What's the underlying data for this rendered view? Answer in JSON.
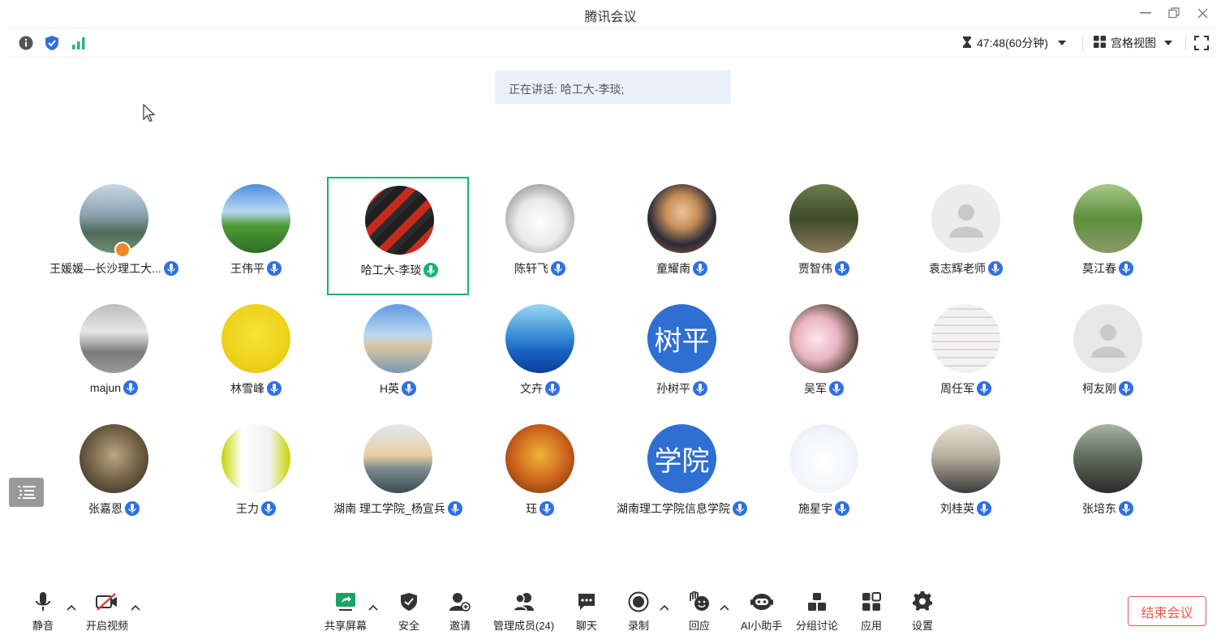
{
  "window": {
    "title": "腾讯会议"
  },
  "infobar": {
    "timer": "47:48(60分钟)",
    "view_mode": "宫格视图"
  },
  "speaking": {
    "label": "正在讲话:",
    "names": "哈工大-李琰;"
  },
  "participants": [
    {
      "name": "王媛媛—长沙理工大...",
      "active": false,
      "host": true,
      "avatar_text": ""
    },
    {
      "name": "王伟平",
      "active": false,
      "host": false,
      "avatar_text": ""
    },
    {
      "name": "哈工大-李琰",
      "active": true,
      "host": false,
      "avatar_text": ""
    },
    {
      "name": "陈轩飞",
      "active": false,
      "host": false,
      "avatar_text": ""
    },
    {
      "name": "童耀南",
      "active": false,
      "host": false,
      "avatar_text": ""
    },
    {
      "name": "贾智伟",
      "active": false,
      "host": false,
      "avatar_text": ""
    },
    {
      "name": "袁志辉老师",
      "active": false,
      "host": false,
      "avatar_text": ""
    },
    {
      "name": "莫江春",
      "active": false,
      "host": false,
      "avatar_text": ""
    },
    {
      "name": "majun",
      "active": false,
      "host": false,
      "avatar_text": ""
    },
    {
      "name": "林雪峰",
      "active": false,
      "host": false,
      "avatar_text": ""
    },
    {
      "name": "H英",
      "active": false,
      "host": false,
      "avatar_text": ""
    },
    {
      "name": "文卉",
      "active": false,
      "host": false,
      "avatar_text": ""
    },
    {
      "name": "孙树平",
      "active": false,
      "host": false,
      "avatar_text": "树平"
    },
    {
      "name": "吴军",
      "active": false,
      "host": false,
      "avatar_text": ""
    },
    {
      "name": "周任军",
      "active": false,
      "host": false,
      "avatar_text": ""
    },
    {
      "name": "柯友刚",
      "active": false,
      "host": false,
      "avatar_text": ""
    },
    {
      "name": "张嘉恩",
      "active": false,
      "host": false,
      "avatar_text": ""
    },
    {
      "name": "王力",
      "active": false,
      "host": false,
      "avatar_text": ""
    },
    {
      "name": "湖南 理工学院_杨宣兵",
      "active": false,
      "host": false,
      "avatar_text": ""
    },
    {
      "name": "珏",
      "active": false,
      "host": false,
      "avatar_text": ""
    },
    {
      "name": "湖南理工学院信息学院",
      "active": false,
      "host": false,
      "avatar_text": "学院"
    },
    {
      "name": "施星宇",
      "active": false,
      "host": false,
      "avatar_text": ""
    },
    {
      "name": "刘桂英",
      "active": false,
      "host": false,
      "avatar_text": ""
    },
    {
      "name": "张培东",
      "active": false,
      "host": false,
      "avatar_text": ""
    }
  ],
  "toolbar": {
    "mute": "静音",
    "video": "开启视频",
    "share": "共享屏幕",
    "security": "安全",
    "invite": "邀请",
    "members": "管理成员(24)",
    "chat": "聊天",
    "record": "录制",
    "react": "回应",
    "ai": "AI小助手",
    "breakout": "分组讨论",
    "apps": "应用",
    "settings": "设置",
    "end": "结束会议"
  },
  "colors": {
    "accent": "#2f6fe4",
    "active_border": "#18b36b",
    "end": "#e25c4b"
  }
}
